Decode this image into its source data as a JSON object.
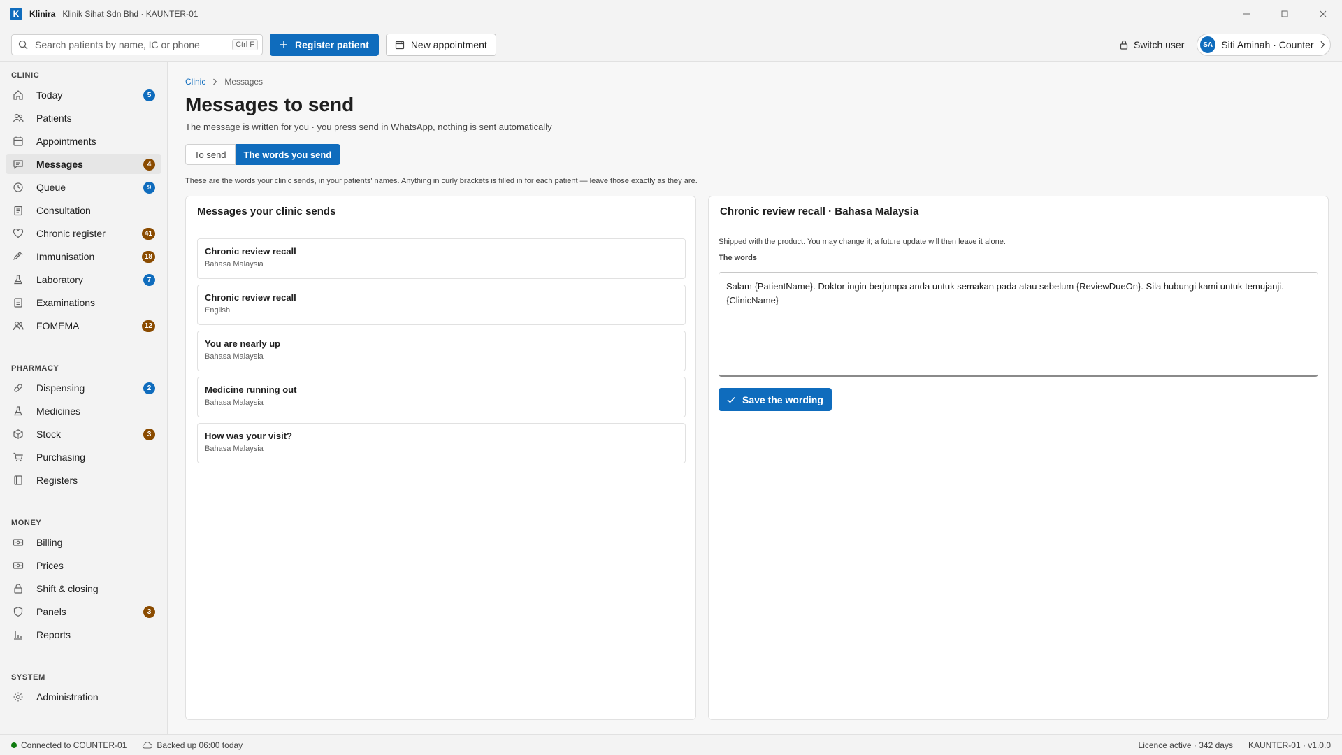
{
  "window": {
    "app_logo": "K",
    "app_name": "Klinira",
    "clinic": "Klinik Sihat Sdn Bhd · KAUNTER-01"
  },
  "toolbar": {
    "search_placeholder": "Search patients by name, IC or phone",
    "search_shortcut": "Ctrl F",
    "register_label": "Register patient",
    "appointment_label": "New appointment",
    "switch_user_label": "Switch user",
    "user_initials": "SA",
    "user_name": "Siti Aminah · Counter"
  },
  "sidebar": {
    "sections": [
      {
        "title": "CLINIC",
        "items": [
          {
            "label": "Today",
            "badge": "5",
            "badge_color": "#0f6cbd",
            "icon": "home-icon"
          },
          {
            "label": "Patients",
            "badge": null,
            "icon": "people-icon"
          },
          {
            "label": "Appointments",
            "badge": null,
            "icon": "calendar-icon"
          },
          {
            "label": "Messages",
            "badge": "4",
            "badge_color": "#8a4b00",
            "icon": "chat-icon",
            "active": true
          },
          {
            "label": "Queue",
            "badge": "9",
            "badge_color": "#0f6cbd",
            "icon": "clock-icon"
          },
          {
            "label": "Consultation",
            "badge": null,
            "icon": "clipboard-icon"
          },
          {
            "label": "Chronic register",
            "badge": "41",
            "badge_color": "#8a4b00",
            "icon": "heart-icon"
          },
          {
            "label": "Immunisation",
            "badge": "18",
            "badge_color": "#8a4b00",
            "icon": "syringe-icon"
          },
          {
            "label": "Laboratory",
            "badge": "7",
            "badge_color": "#0f6cbd",
            "icon": "flask-icon"
          },
          {
            "label": "Examinations",
            "badge": null,
            "icon": "document-icon"
          },
          {
            "label": "FOMEMA",
            "badge": "12",
            "badge_color": "#8a4b00",
            "icon": "people-icon"
          }
        ]
      },
      {
        "title": "PHARMACY",
        "items": [
          {
            "label": "Dispensing",
            "badge": "2",
            "badge_color": "#0f6cbd",
            "icon": "pill-icon"
          },
          {
            "label": "Medicines",
            "badge": null,
            "icon": "flask-icon"
          },
          {
            "label": "Stock",
            "badge": "3",
            "badge_color": "#8a4b00",
            "icon": "box-icon"
          },
          {
            "label": "Purchasing",
            "badge": null,
            "icon": "cart-icon"
          },
          {
            "label": "Registers",
            "badge": null,
            "icon": "book-icon"
          }
        ]
      },
      {
        "title": "MONEY",
        "items": [
          {
            "label": "Billing",
            "badge": null,
            "icon": "money-icon"
          },
          {
            "label": "Prices",
            "badge": null,
            "icon": "money-icon"
          },
          {
            "label": "Shift & closing",
            "badge": null,
            "icon": "lock-icon"
          },
          {
            "label": "Panels",
            "badge": "3",
            "badge_color": "#8a4b00",
            "icon": "shield-icon"
          },
          {
            "label": "Reports",
            "badge": null,
            "icon": "bar-chart-icon"
          }
        ]
      },
      {
        "title": "SYSTEM",
        "items": [
          {
            "label": "Administration",
            "badge": null,
            "icon": "gear-icon"
          }
        ]
      }
    ]
  },
  "main": {
    "breadcrumb": [
      "Clinic",
      "Messages"
    ],
    "title": "Messages to send",
    "subtitle": "The message is written for you · you press send in WhatsApp, nothing is sent automatically",
    "tabs": [
      {
        "label": "To send",
        "active": false
      },
      {
        "label": "The words you send",
        "active": true
      }
    ],
    "intro": "These are the words your clinic sends, in your patients' names. Anything in curly brackets is filled in for each patient — leave those exactly as they are.",
    "list_title": "Messages your clinic sends",
    "templates": [
      {
        "name": "Chronic review recall",
        "lang": "Bahasa Malaysia"
      },
      {
        "name": "Chronic review recall",
        "lang": "English"
      },
      {
        "name": "You are nearly up",
        "lang": "Bahasa Malaysia"
      },
      {
        "name": "Medicine running out",
        "lang": "Bahasa Malaysia"
      },
      {
        "name": "How was your visit?",
        "lang": "Bahasa Malaysia"
      }
    ],
    "editor": {
      "title": "Chronic review recall · Bahasa Malaysia",
      "note": "Shipped with the product. You may change it; a future update will then leave it alone.",
      "words_label": "The words",
      "text": "Salam {PatientName}. Doktor ingin berjumpa anda untuk semakan pada atau sebelum {ReviewDueOn}. Sila hubungi kami untuk temujanji. — {ClinicName}",
      "save_label": "Save the wording"
    }
  },
  "statusbar": {
    "connection": "Connected to COUNTER-01",
    "backup": "Backed up 06:00 today",
    "licence": "Licence active · 342 days",
    "version": "KAUNTER-01 · v1.0.0"
  }
}
